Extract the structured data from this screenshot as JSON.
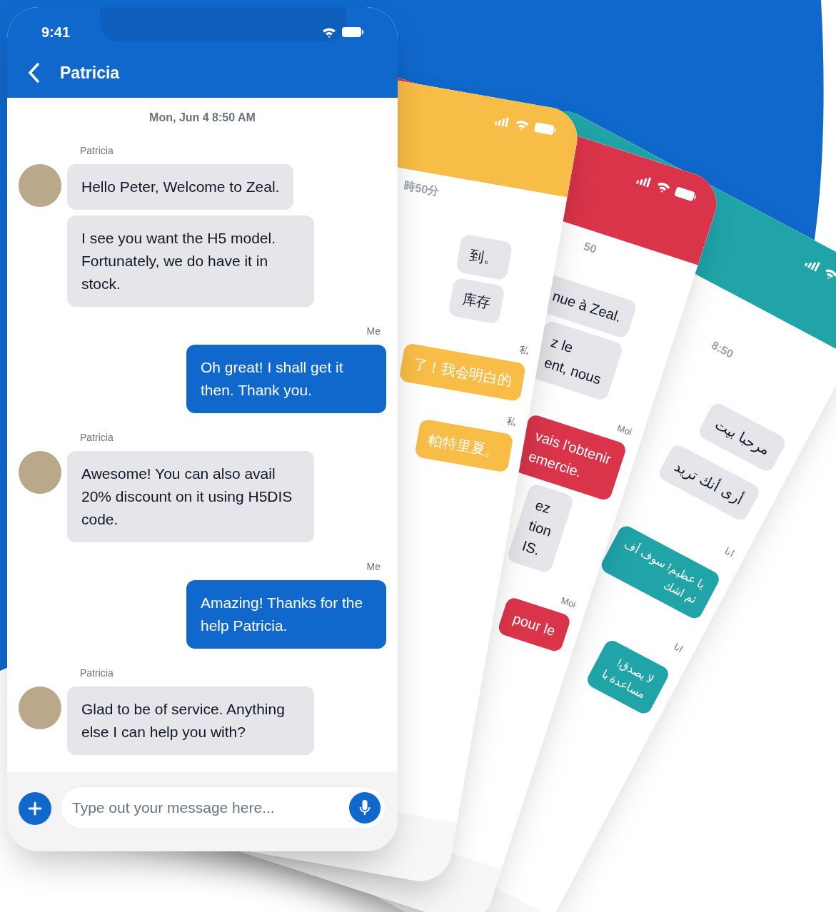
{
  "phone": {
    "status_time": "9:41",
    "header_title": "Patricia",
    "date": "Mon, Jun 4 8:50 AM",
    "messages": [
      {
        "kind": "incoming",
        "sender": "Patricia",
        "bubbles": [
          "Hello Peter, Welcome to Zeal.",
          "I see you want the H5 model. Fortunately, we do have it in stock."
        ]
      },
      {
        "kind": "outgoing",
        "sender": "Me",
        "bubbles": [
          "Oh great! I shall get it then. Thank you."
        ]
      },
      {
        "kind": "incoming",
        "sender": "Patricia",
        "bubbles": [
          "Awesome! You can also avail 20% discount on it using H5DIS code."
        ]
      },
      {
        "kind": "outgoing",
        "sender": "Me",
        "bubbles": [
          "Amazing! Thanks for the help Patricia."
        ]
      },
      {
        "kind": "incoming",
        "sender": "Patricia",
        "bubbles": [
          "Glad to be of service. Anything else I can help you with?"
        ]
      }
    ],
    "input": {
      "placeholder": "Type out your message here..."
    }
  },
  "background_phones": [
    {
      "color": "#20a4a8",
      "items": [
        {
          "kind": "date",
          "text": "8:50"
        },
        {
          "kind": "incoming",
          "text": "مرحبا بيت"
        },
        {
          "kind": "incoming",
          "text": "أرى أنك تريد"
        },
        {
          "kind": "label",
          "text": "انا"
        },
        {
          "kind": "outgoing",
          "text": "يا عظيم! سوف أف\nثم اشك"
        },
        {
          "kind": "label",
          "text": "انا"
        },
        {
          "kind": "outgoing",
          "text": "لا يصدق!\nمساعدة با"
        }
      ]
    },
    {
      "color": "#d9344a",
      "items": [
        {
          "kind": "date",
          "text": "50"
        },
        {
          "kind": "incoming",
          "text": "nue à Zeal."
        },
        {
          "kind": "incoming",
          "text": "z le\nent, nous"
        },
        {
          "kind": "label",
          "text": "Moi"
        },
        {
          "kind": "outgoing",
          "text": "vais l'obtenir\nemercie."
        },
        {
          "kind": "incoming",
          "text": "ez\ntion\nIS."
        },
        {
          "kind": "label",
          "text": "Moi"
        },
        {
          "kind": "outgoing",
          "text": "pour le"
        }
      ]
    },
    {
      "color": "#f8bd46",
      "items": [
        {
          "kind": "date",
          "text": "時50分"
        },
        {
          "kind": "incoming",
          "text": "到。"
        },
        {
          "kind": "incoming",
          "text": "库存"
        },
        {
          "kind": "label",
          "text": "私"
        },
        {
          "kind": "outgoing",
          "text": "了！我会明白的"
        },
        {
          "kind": "label",
          "text": "私"
        },
        {
          "kind": "outgoing",
          "text": "帕特里夏。"
        }
      ]
    }
  ]
}
